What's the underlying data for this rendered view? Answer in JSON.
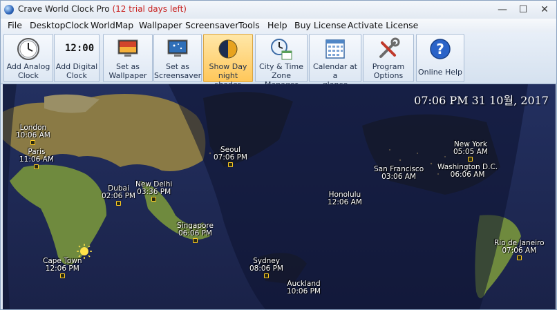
{
  "window": {
    "title": "Crave World Clock Pro",
    "trial": "(12 trial days left)",
    "controls": {
      "minimize": "—",
      "maximize": "☐",
      "close": "✕"
    }
  },
  "menu": [
    "File",
    "DesktopClock",
    "WorldMap",
    "Wallpaper",
    "Screensaver",
    "Tools",
    "Help",
    "Buy License",
    "Activate License"
  ],
  "toolbar": {
    "add_analog": "Add Analog\nClock",
    "add_digital": "Add Digital\nClock",
    "digital_icon_text": "12:00",
    "set_wallpaper": "Set as\nWallpaper",
    "set_screensaver": "Set as\nScreensaver",
    "day_night": "Show Day\nnight shades",
    "city_time": "City & Time\nZone Manager",
    "calendar": "Calendar at a\nglance",
    "options": "Program\nOptions",
    "help": "Online Help"
  },
  "map": {
    "current_time": "07:06 PM 31 10월, 2017",
    "cities": [
      {
        "name": "London",
        "time": "10:06 AM"
      },
      {
        "name": "Paris",
        "time": "11:06 AM"
      },
      {
        "name": "Dubai",
        "time": "02:06 PM"
      },
      {
        "name": "New Delhi",
        "time": "03:36 PM"
      },
      {
        "name": "Seoul",
        "time": "07:06 PM"
      },
      {
        "name": "Singapore",
        "time": "06:06 PM"
      },
      {
        "name": "Cape Town",
        "time": "12:06 PM"
      },
      {
        "name": "Sydney",
        "time": "08:06 PM"
      },
      {
        "name": "Auckland",
        "time": "10:06 PM"
      },
      {
        "name": "Honolulu",
        "time": "12:06 AM"
      },
      {
        "name": "San Francisco",
        "time": "03:06 AM"
      },
      {
        "name": "New York",
        "time": "05:05 AM"
      },
      {
        "name": "Washington D.C.",
        "time": "06:06 AM"
      },
      {
        "name": "Rio de Janeiro",
        "time": "07:06 AM"
      }
    ]
  }
}
